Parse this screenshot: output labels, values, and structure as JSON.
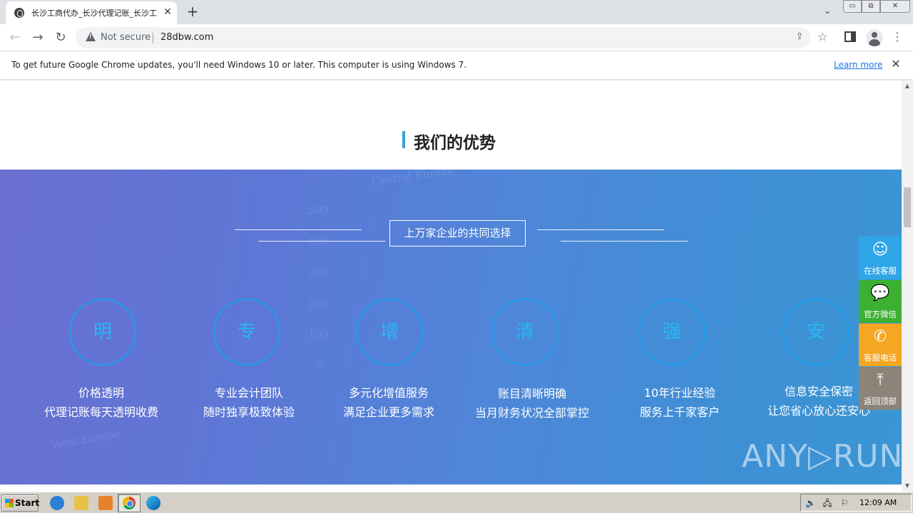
{
  "browser": {
    "tab_title": "长沙工商代办_长沙代理记账_长沙工",
    "url": "28dbw.com",
    "security_label": "Not secure",
    "new_tab_symbol": "+",
    "infobar_text": "To get future Google Chrome updates, you'll need Windows 10 or later. This computer is using Windows 7.",
    "infobar_link": "Learn more"
  },
  "page": {
    "section_title": "我们的优势",
    "banner_box": "上万家企业的共同选择",
    "features": [
      {
        "char": "明",
        "line1": "价格透明",
        "line2": "代理记账每天透明收费"
      },
      {
        "char": "专",
        "line1": "专业会计团队",
        "line2": "随时独享极致体验"
      },
      {
        "char": "增",
        "line1": "多元化增值服务",
        "line2": "满足企业更多需求"
      },
      {
        "char": "清",
        "line1": "账目清晰明确",
        "line2": "当月财务状况全部掌控"
      },
      {
        "char": "强",
        "line1": "10年行业经验",
        "line2": "服务上千家客户"
      },
      {
        "char": "安",
        "line1": "信息安全保密",
        "line2": "让您省心放心还安心"
      }
    ],
    "background_text": {
      "central": "Central Europe",
      "west": "West Europe",
      "ticks": [
        "500",
        "400",
        "300",
        "200",
        "100",
        "0"
      ]
    }
  },
  "side_buttons": [
    {
      "label": "在线客服",
      "icon": "qq-icon"
    },
    {
      "label": "官方微信",
      "icon": "wechat-icon"
    },
    {
      "label": "客服电话",
      "icon": "phone-icon"
    },
    {
      "label": "返回顶部",
      "icon": "back-to-top-icon"
    }
  ],
  "watermark": "ANY▷RUN",
  "taskbar": {
    "start_label": "Start",
    "clock": "12:09 AM"
  },
  "colors": {
    "accent": "#3ba0d8",
    "circle_border": "#1aa0f0",
    "side_qq": "#2ea6e8",
    "side_wechat": "#3cb033",
    "side_phone": "#f5a623",
    "side_top": "#8c8478"
  }
}
